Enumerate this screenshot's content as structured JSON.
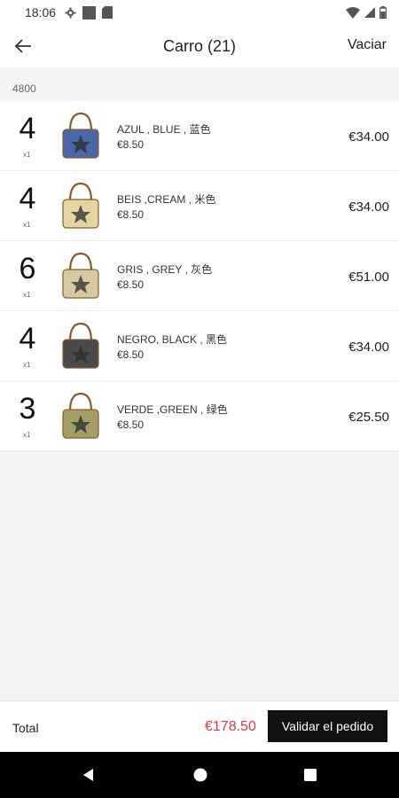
{
  "status_bar": {
    "time": "18:06"
  },
  "header": {
    "title": "Carro (21)",
    "clear_label": "Vaciar"
  },
  "reference": "4800",
  "items": [
    {
      "qty": "4",
      "multiplier": "x1",
      "name": "AZUL , BLUE , 蓝色",
      "unit_price": "€8.50",
      "line_total": "€34.00",
      "color": "#4a67a8"
    },
    {
      "qty": "4",
      "multiplier": "x1",
      "name": "BEIS ,CREAM , 米色",
      "unit_price": "€8.50",
      "line_total": "€34.00",
      "color": "#e4d6a2"
    },
    {
      "qty": "6",
      "multiplier": "x1",
      "name": "GRIS , GREY , 灰色",
      "unit_price": "€8.50",
      "line_total": "€51.00",
      "color": "#d6caa4"
    },
    {
      "qty": "4",
      "multiplier": "x1",
      "name": "NEGRO, BLACK , 黑色",
      "unit_price": "€8.50",
      "line_total": "€34.00",
      "color": "#4a4a4a"
    },
    {
      "qty": "3",
      "multiplier": "x1",
      "name": "VERDE ,GREEN , 绿色",
      "unit_price": "€8.50",
      "line_total": "€25.50",
      "color": "#a3a065"
    }
  ],
  "footer": {
    "total_label": "Total",
    "total_value": "€178.50",
    "validate_label": "Validar el pedido"
  },
  "colors": {
    "accent": "#e23744",
    "primary_button": "#111111"
  }
}
